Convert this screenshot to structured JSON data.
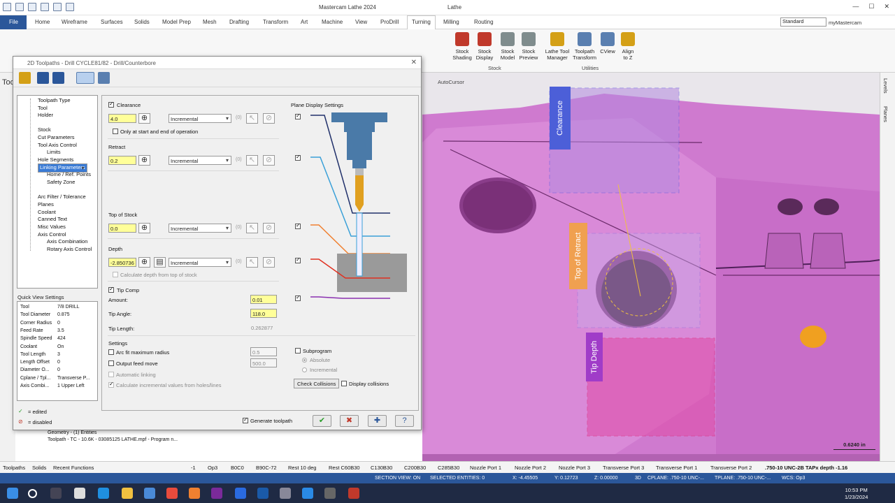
{
  "window": {
    "title": "Mastercam Lathe 2024",
    "context_tab": "Lathe",
    "controls": [
      "—",
      "☐",
      "✕"
    ]
  },
  "menu": {
    "file": "File",
    "tabs": [
      "Home",
      "Wireframe",
      "Surfaces",
      "Solids",
      "Model Prep",
      "Mesh",
      "Drafting",
      "Transform",
      "Art",
      "Machine",
      "View",
      "ProDrill",
      "Turning",
      "Milling",
      "Routing"
    ],
    "active": "Turning",
    "view_select": "Standard",
    "account": "myMastercam"
  },
  "ribbon": {
    "buttons": [
      {
        "label": "Stock\nShading",
        "icon": "stock-shading-icon",
        "color": "#c0392b"
      },
      {
        "label": "Stock\nDisplay",
        "icon": "stock-display-icon",
        "color": "#c0392b"
      },
      {
        "label": "Stock\nModel",
        "icon": "stock-model-icon",
        "color": "#7f8c8d"
      },
      {
        "label": "Stock\nPreview",
        "icon": "stock-preview-icon",
        "color": "#7f8c8d"
      },
      {
        "label": "Lathe Tool\nManager",
        "icon": "tool-manager-icon",
        "color": "#d4a017"
      },
      {
        "label": "Toolpath\nTransform",
        "icon": "toolpath-transform-icon",
        "color": "#5a7fb0"
      },
      {
        "label": "CView",
        "icon": "cview-icon",
        "color": "#5a7fb0"
      },
      {
        "label": "Align\nto Z",
        "icon": "align-z-icon",
        "color": "#d4a017"
      }
    ],
    "groups": [
      "Stock",
      "Utilities"
    ]
  },
  "dialog": {
    "title": "2D Toolpaths - Drill CYCLE81/82 - Drill/Counterbore",
    "tree": [
      {
        "label": "Toolpath Type",
        "level": 0
      },
      {
        "label": "Tool",
        "level": 0
      },
      {
        "label": "Holder",
        "level": 0
      },
      {
        "label": "Stock",
        "level": 0
      },
      {
        "label": "Cut Parameters",
        "level": 0
      },
      {
        "label": "Tool Axis Control",
        "level": 0
      },
      {
        "label": "Limits",
        "level": 1
      },
      {
        "label": "Hole Segments",
        "level": 0
      },
      {
        "label": "Linking Parameters",
        "level": 0,
        "selected": true
      },
      {
        "label": "Home / Ref. Points",
        "level": 1
      },
      {
        "label": "Safety Zone",
        "level": 1
      },
      {
        "label": "Arc Filter / Tolerance",
        "level": 0
      },
      {
        "label": "Planes",
        "level": 0
      },
      {
        "label": "Coolant",
        "level": 0
      },
      {
        "label": "Canned Text",
        "level": 0
      },
      {
        "label": "Misc Values",
        "level": 0
      },
      {
        "label": "Axis Control",
        "level": 0
      },
      {
        "label": "Axis Combination",
        "level": 1
      },
      {
        "label": "Rotary Axis Control",
        "level": 1
      }
    ],
    "quick_view": {
      "title": "Quick View Settings",
      "rows": [
        [
          "Tool",
          "7/8 DRILL"
        ],
        [
          "Tool Diameter",
          "0.875"
        ],
        [
          "Corner Radius",
          "0"
        ],
        [
          "Feed Rate",
          "3.5"
        ],
        [
          "Spindle Speed",
          "424"
        ],
        [
          "Coolant",
          "On"
        ],
        [
          "Tool Length",
          "3"
        ],
        [
          "Length Offset",
          "0"
        ],
        [
          "Diameter O...",
          "0"
        ],
        [
          "Cplane / Tpl...",
          "Transverse P..."
        ],
        [
          "Axis Combi...",
          "1 Upper Left"
        ]
      ]
    },
    "legend": {
      "edited": "= edited",
      "disabled": "= disabled"
    },
    "clearance": {
      "label": "Clearance",
      "value": "4.0",
      "mode": "Incremental",
      "only_start_end": "Only at start and end of operation"
    },
    "retract": {
      "label": "Retract",
      "value": "0.2",
      "mode": "Incremental"
    },
    "top_of_stock": {
      "label": "Top of Stock",
      "value": "0.0",
      "mode": "Incremental"
    },
    "depth": {
      "label": "Depth",
      "value": "-2.850736",
      "mode": "Incremental",
      "calc": "Calculate depth from top of stock"
    },
    "zero_label": "(0)",
    "tip_comp": {
      "label": "Tip Comp",
      "amount_label": "Amount:",
      "amount": "0.01",
      "angle_label": "Tip Angle:",
      "angle": "118.0",
      "length_label": "Tip Length:",
      "length": "0.262877"
    },
    "plane_display": "Plane Display Settings",
    "settings": {
      "title": "Settings",
      "arc_fit": "Arc fit maximum radius",
      "arc_fit_value": "0.5",
      "output_feed": "Output feed move",
      "output_feed_value": "500.0",
      "auto_link": "Automatic linking",
      "calc_incr": "Calculate incremental values from holes/lines",
      "subprogram": "Subprogram",
      "absolute": "Absolute",
      "incremental": "Incremental",
      "check_collisions": "Check Collisions",
      "display_collisions": "Display collisions"
    },
    "generate_toolpath": "Generate toolpath"
  },
  "viewport": {
    "labels": [
      "Clearance",
      "Top of Retract",
      "Tip Depth"
    ],
    "autocursor": "AutoCursor",
    "scale": "0.6240 in"
  },
  "side_tabs": [
    "Levels",
    "Planes"
  ],
  "left_tab": "Tool",
  "manager": {
    "geometry": "Geometry - (1) Entities",
    "toolpath": "Toolpath - TC - 10.6K - 03085125 LATHE.mpf - Program n..."
  },
  "bottom_tabs_left": [
    "Toolpaths",
    "Solids",
    "Recent Functions"
  ],
  "bottom_tabs": [
    "-1",
    "Op3",
    "B0C0",
    "B90C-72",
    "Rest 10 deg",
    "Rest C60B30",
    "C130B30",
    "C200B30",
    "C285B30",
    "Nozzle Port 1",
    "Nozzle Port 2",
    "Nozzle Port 3",
    "Transverse Port 3",
    "Transverse Port 1",
    "Transverse Port 2",
    ".750-10 UNC-2B TAPx depth -1.16"
  ],
  "status": {
    "section": "SECTION VIEW: ON",
    "selected": "SELECTED ENTITIES: 0",
    "x": "X:   -4.45505",
    "y": "Y:   0.12723",
    "z": "Z:   0.00000",
    "mode": "3D",
    "cplane": "CPLANE: .750-10 UNC-...",
    "tplane": "TPLANE: .750-10 UNC-...",
    "wcs": "WCS: Op3"
  },
  "clock": {
    "time": "10:53 PM",
    "date": "1/23/2024"
  },
  "colors": {
    "accent": "#2b579a",
    "highlight": "#ffff99",
    "part": "#d57fd6",
    "taskbar": "#1f2a44"
  }
}
